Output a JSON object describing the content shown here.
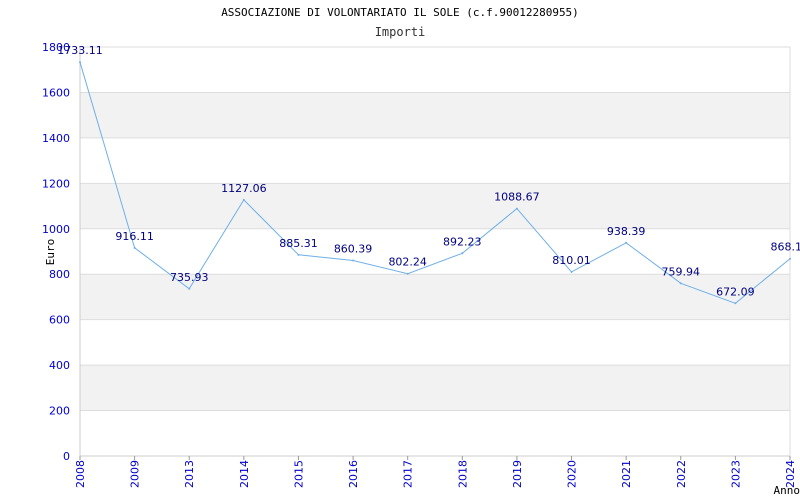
{
  "chart_data": {
    "type": "line",
    "title": "ASSOCIAZIONE DI VOLONTARIATO IL SOLE (c.f.90012280955)",
    "subtitle": "Importi",
    "xlabel": "Anno",
    "ylabel": "Euro",
    "ylim": [
      0,
      1800
    ],
    "yticks": [
      "0",
      "200",
      "400",
      "600",
      "800",
      "1000",
      "1200",
      "1400",
      "1600",
      "1800"
    ],
    "categories": [
      "2008",
      "2009",
      "2013",
      "2014",
      "2015",
      "2016",
      "2017",
      "2018",
      "2019",
      "2020",
      "2021",
      "2022",
      "2023",
      "2024"
    ],
    "values": [
      1733.11,
      916.11,
      735.93,
      1127.06,
      885.31,
      860.39,
      802.24,
      892.23,
      1088.67,
      810.01,
      938.39,
      759.94,
      672.09,
      868.1
    ],
    "value_labels": [
      "1733.11",
      "916.11",
      "735.93",
      "1127.06",
      "885.31",
      "860.39",
      "802.24",
      "892.23",
      "1088.67",
      "810.01",
      "938.39",
      "759.94",
      "672.09",
      "868.1"
    ],
    "grid": true,
    "colors": {
      "line": "#6fb0e8",
      "band": "#f2f2f2",
      "tick_text": "#0000cc",
      "value_text": "#000080"
    }
  }
}
